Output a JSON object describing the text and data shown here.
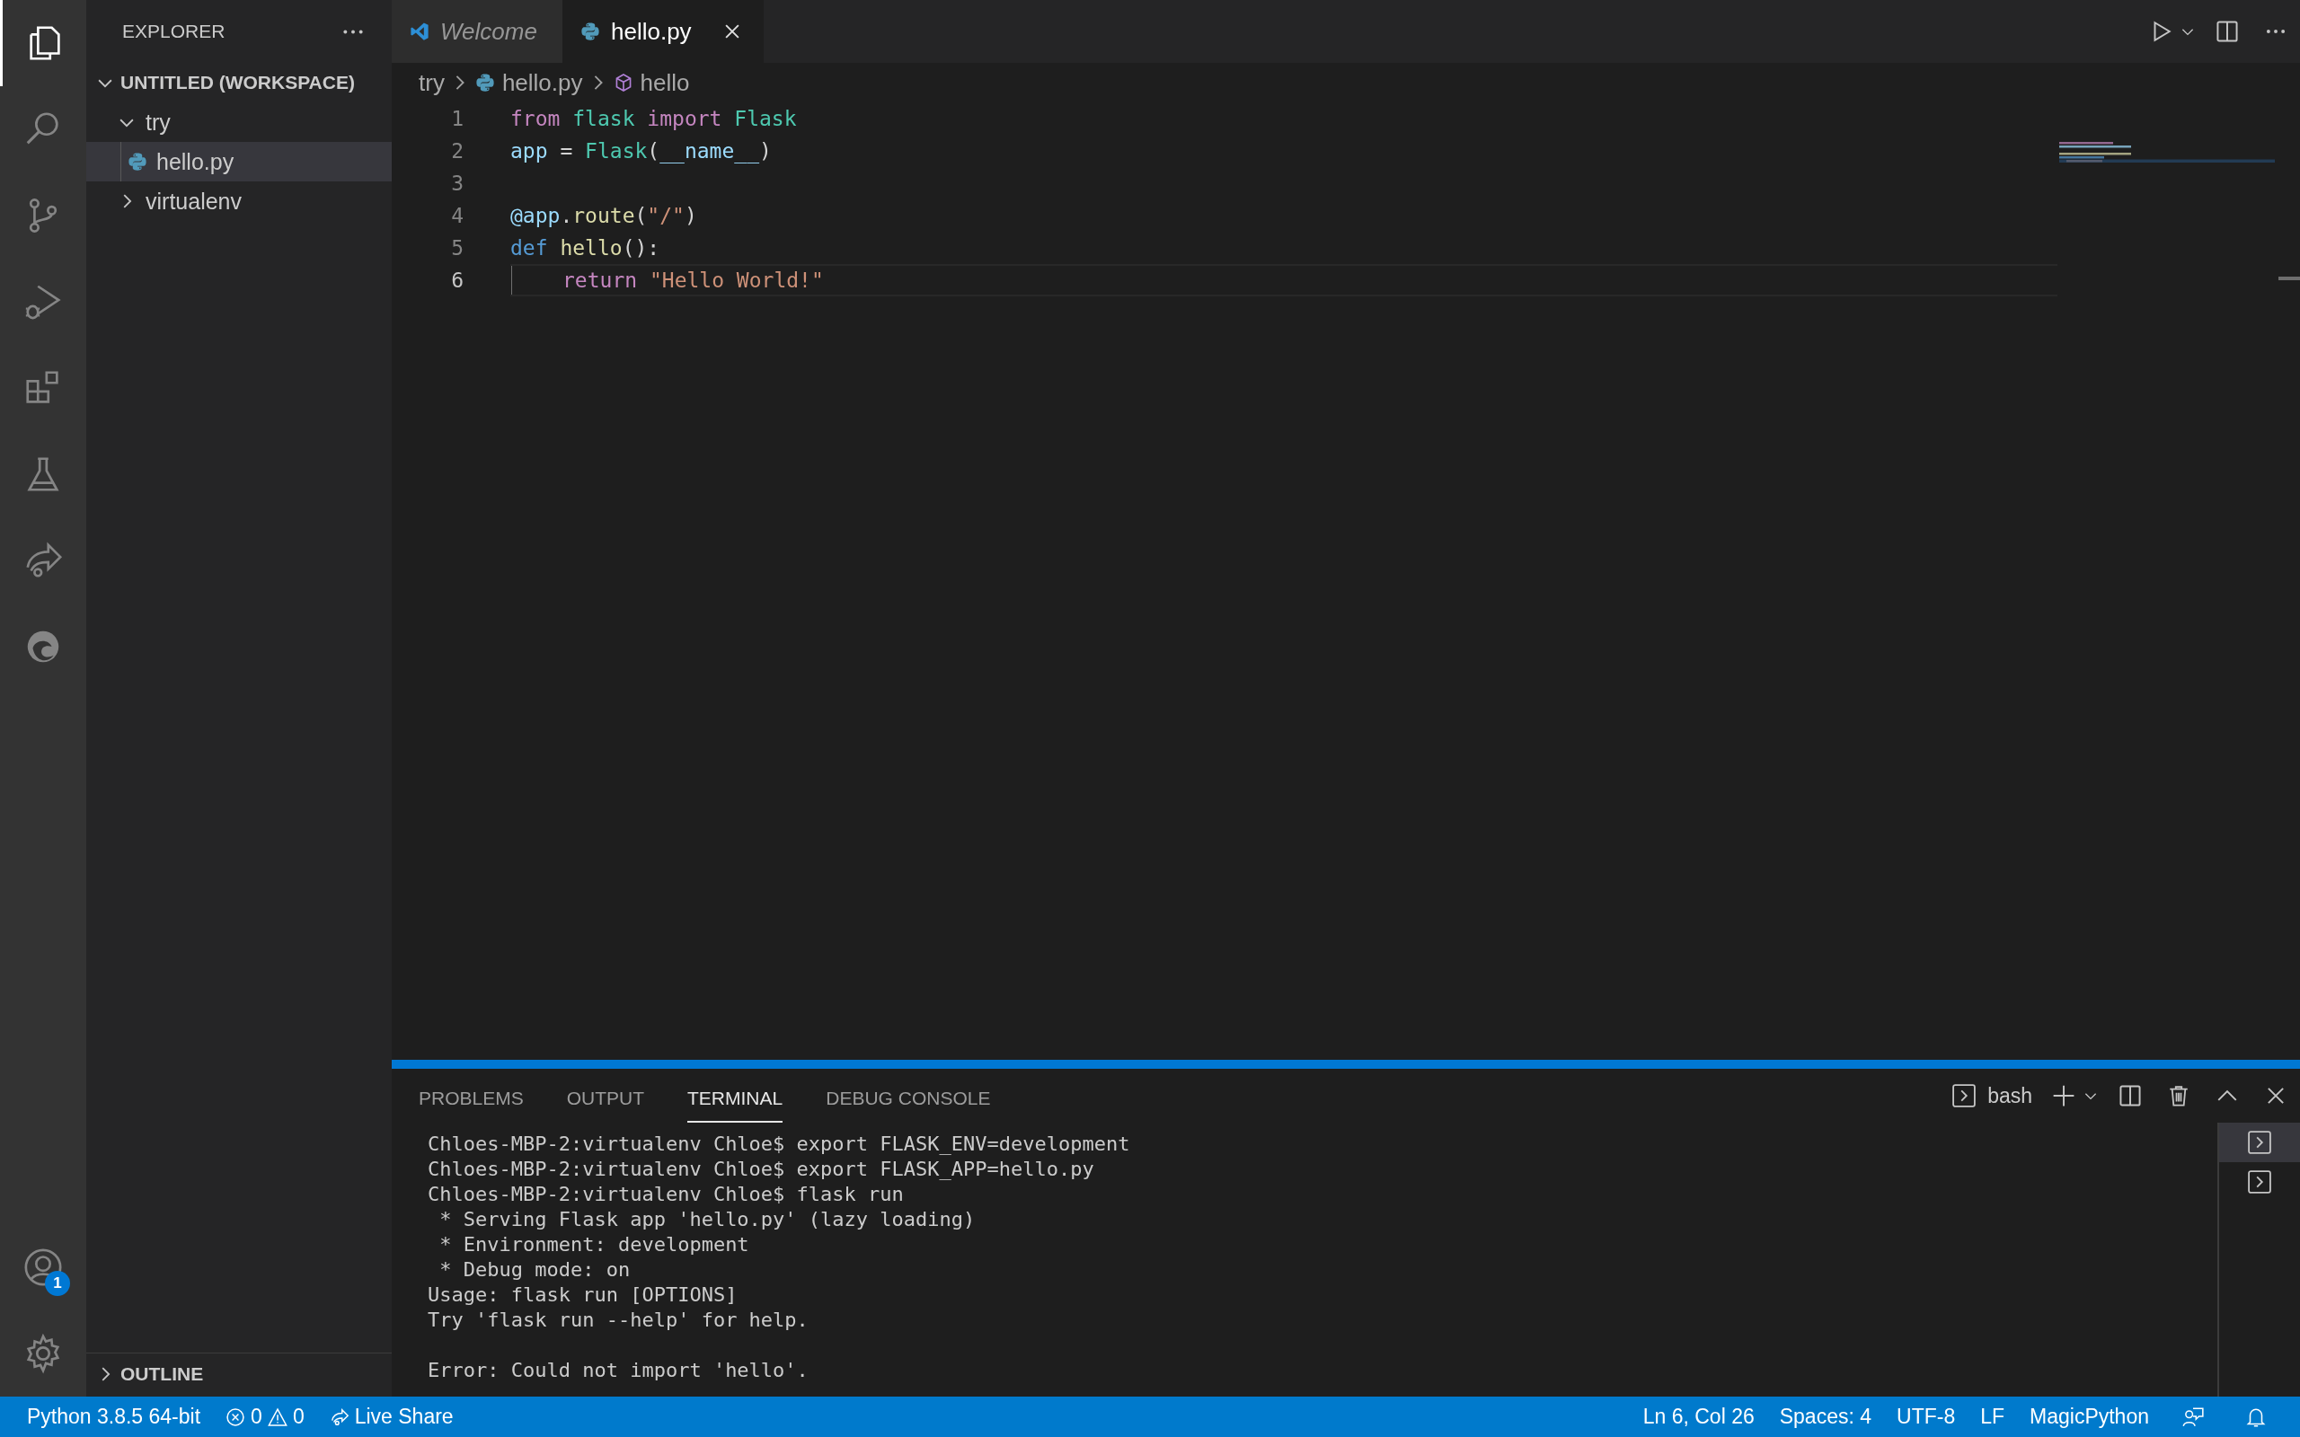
{
  "activity_bar": {
    "items": [
      {
        "kind": "explorer",
        "selected": true
      },
      {
        "kind": "search",
        "selected": false
      },
      {
        "kind": "source-control",
        "selected": false
      },
      {
        "kind": "run",
        "selected": false
      },
      {
        "kind": "extensions",
        "selected": false
      },
      {
        "kind": "testing",
        "selected": false
      },
      {
        "kind": "live-share",
        "selected": false
      },
      {
        "kind": "edge",
        "selected": false
      }
    ],
    "accounts_badge": "1"
  },
  "sidebar": {
    "title": "EXPLORER",
    "workspace": {
      "label": "UNTITLED (WORKSPACE)",
      "expanded": true,
      "children": [
        {
          "label": "try",
          "kind": "folder",
          "expanded": true,
          "selected": false,
          "children": [
            {
              "label": "hello.py",
              "kind": "python",
              "selected": true
            }
          ]
        },
        {
          "label": "virtualenv",
          "kind": "folder",
          "expanded": false,
          "selected": false
        }
      ]
    },
    "outline": {
      "label": "OUTLINE",
      "expanded": false
    }
  },
  "tabs": [
    {
      "label": "Welcome",
      "kind": "vscode",
      "selected": false,
      "preview": true
    },
    {
      "label": "hello.py",
      "kind": "python",
      "selected": true,
      "preview": false
    }
  ],
  "breadcrumbs": [
    {
      "label": "try",
      "kind": "folder"
    },
    {
      "label": "hello.py",
      "kind": "python"
    },
    {
      "label": "hello",
      "kind": "symbol"
    }
  ],
  "code": {
    "lines": [
      {
        "number": "1",
        "current": false,
        "indented": false,
        "tokens": [
          {
            "text": "from ",
            "kind": "keyword"
          },
          {
            "text": "flask ",
            "kind": "class"
          },
          {
            "text": "import ",
            "kind": "keyword"
          },
          {
            "text": "Flask",
            "kind": "class"
          }
        ]
      },
      {
        "number": "2",
        "current": false,
        "indented": false,
        "tokens": [
          {
            "text": "app",
            "kind": "variable"
          },
          {
            "text": " = ",
            "kind": "plain"
          },
          {
            "text": "Flask",
            "kind": "class"
          },
          {
            "text": "(",
            "kind": "plain"
          },
          {
            "text": "__name__",
            "kind": "variable"
          },
          {
            "text": ")",
            "kind": "plain"
          }
        ]
      },
      {
        "number": "3",
        "current": false,
        "indented": false
      },
      {
        "number": "4",
        "current": false,
        "indented": false,
        "tokens": [
          {
            "text": "@app",
            "kind": "variable"
          },
          {
            "text": ".",
            "kind": "plain"
          },
          {
            "text": "route",
            "kind": "function"
          },
          {
            "text": "(",
            "kind": "plain"
          },
          {
            "text": "\"/\"",
            "kind": "string"
          },
          {
            "text": ")",
            "kind": "plain"
          }
        ]
      },
      {
        "number": "5",
        "current": false,
        "indented": false,
        "tokens": [
          {
            "text": "def ",
            "kind": "storage"
          },
          {
            "text": "hello",
            "kind": "function"
          },
          {
            "text": "():",
            "kind": "plain"
          }
        ]
      },
      {
        "number": "6",
        "current": true,
        "indented": true,
        "tokens": [
          {
            "text": "return ",
            "kind": "keyword"
          },
          {
            "text": "\"Hello World!\"",
            "kind": "string"
          }
        ]
      }
    ]
  },
  "panel": {
    "tabs": [
      {
        "label": "PROBLEMS",
        "selected": false
      },
      {
        "label": "OUTPUT",
        "selected": false
      },
      {
        "label": "TERMINAL",
        "selected": true
      },
      {
        "label": "DEBUG CONSOLE",
        "selected": false
      }
    ],
    "terminal_picker": "bash",
    "terminal_instances": [
      {
        "selected": true
      },
      {
        "selected": false
      }
    ],
    "terminal_blocks": [
      [
        "Chloes-MBP-2:virtualenv Chloe$ export FLASK_ENV=development",
        "Chloes-MBP-2:virtualenv Chloe$ export FLASK_APP=hello.py",
        "Chloes-MBP-2:virtualenv Chloe$ flask run",
        " * Serving Flask app 'hello.py' (lazy loading)",
        " * Environment: development",
        " * Debug mode: on",
        "Usage: flask run [OPTIONS]",
        "Try 'flask run --help' for help."
      ],
      [
        "Error: Could not import 'hello'."
      ]
    ]
  },
  "status_bar": {
    "interpreter": "Python 3.8.5 64-bit",
    "errors": "0",
    "warnings": "0",
    "live_share": "Live Share",
    "right": [
      "Ln 6, Col 26",
      "Spaces: 4",
      "UTF-8",
      "LF",
      "MagicPython"
    ]
  }
}
